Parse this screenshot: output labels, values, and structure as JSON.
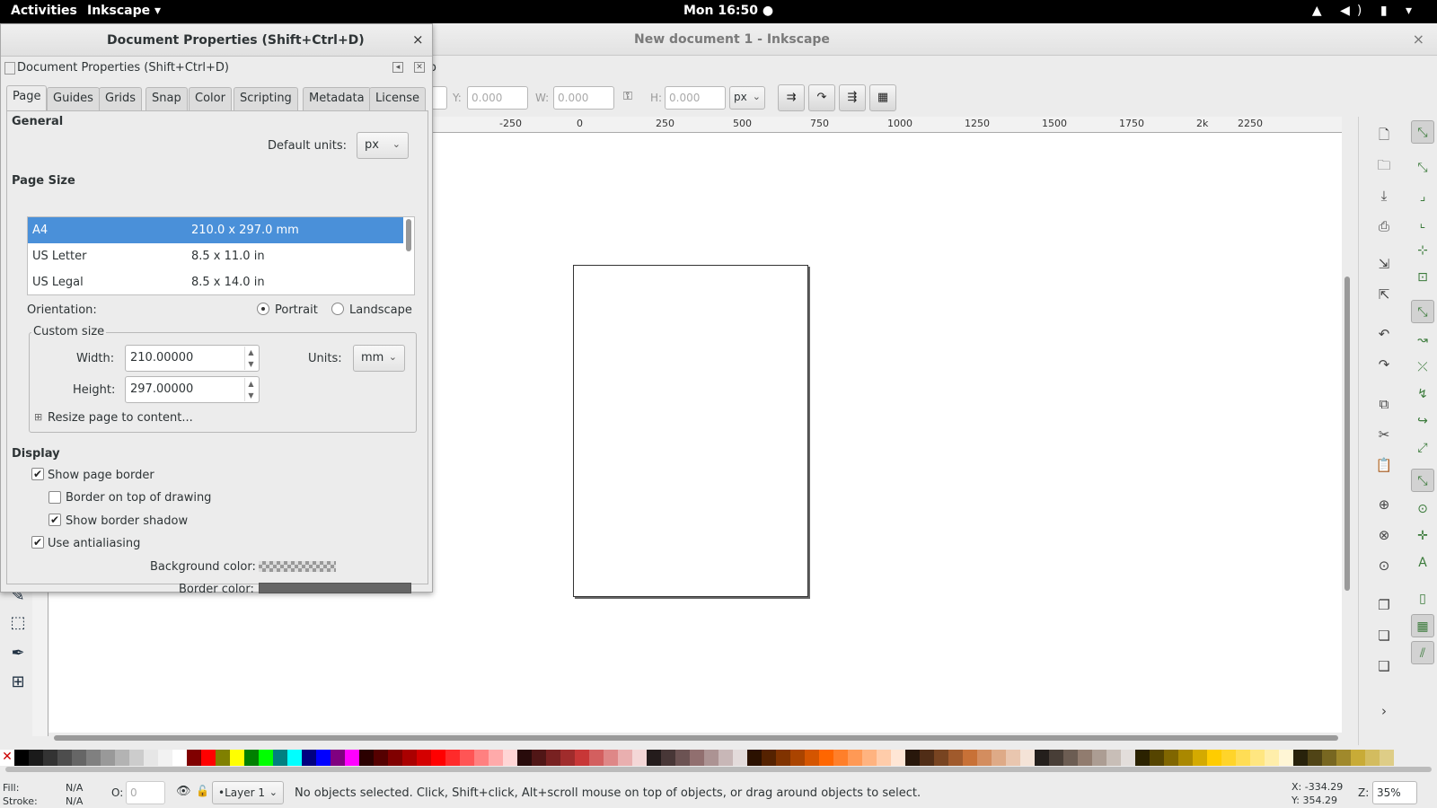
{
  "topbar": {
    "activities": "Activities",
    "app_menu": "Inkscape ▾",
    "clock": "Mon 16:50 ●",
    "tray": "▲ ◀) ▮ ▾"
  },
  "window": {
    "title": "New document 1 - Inkscape",
    "close": "×"
  },
  "menu_fragment": "lp",
  "selector_bar": {
    "y_label": "Y:",
    "y_value": "0.000",
    "w_label": "W:",
    "w_value": "0.000",
    "h_label": "H:",
    "h_value": "0.000",
    "units": "px"
  },
  "ruler": {
    "labels": [
      "0",
      "-250",
      "0",
      "250",
      "500",
      "750",
      "1000",
      "1250",
      "1500",
      "1750",
      "2k",
      "2250"
    ]
  },
  "dialog": {
    "window_title": "Document Properties (Shift+Ctrl+D)",
    "dock_title": "Document Properties (Shift+Ctrl+D)",
    "close": "×",
    "tabs": [
      "Page",
      "Guides",
      "Grids",
      "Snap",
      "Color",
      "Scripting",
      "Metadata",
      "License"
    ],
    "active_tab": "Page",
    "general": {
      "heading": "General",
      "default_units_label": "Default units:",
      "default_units_value": "px"
    },
    "page_size": {
      "heading": "Page Size",
      "rows": [
        {
          "name": "A4",
          "size": "210.0 x 297.0 mm",
          "selected": true
        },
        {
          "name": "US Letter",
          "size": "8.5 x 11.0 in",
          "selected": false
        },
        {
          "name": "US Legal",
          "size": "8.5 x 14.0 in",
          "selected": false
        }
      ],
      "orientation_label": "Orientation:",
      "portrait": "Portrait",
      "landscape": "Landscape",
      "orientation_selected": "Portrait"
    },
    "custom_size": {
      "legend": "Custom size",
      "width_label": "Width:",
      "width_value": "210.00000",
      "height_label": "Height:",
      "height_value": "297.00000",
      "units_label": "Units:",
      "units_value": "mm",
      "resize_expander": "Resize page to content..."
    },
    "display": {
      "heading": "Display",
      "show_page_border": "Show page border",
      "border_on_top": "Border on top of drawing",
      "show_border_shadow": "Show border shadow",
      "use_antialiasing": "Use antialiasing",
      "checked": {
        "show_page_border": true,
        "border_on_top": false,
        "show_border_shadow": true,
        "use_antialiasing": true
      },
      "background_color_label": "Background color:",
      "border_color_label": "Border color:",
      "border_color": "#666666"
    }
  },
  "statusbar": {
    "fill_label": "Fill:",
    "fill_value": "N/A",
    "stroke_label": "Stroke:",
    "stroke_value": "N/A",
    "opacity_label": "O:",
    "opacity_value": "0",
    "layer": "•Layer 1",
    "message": "No objects selected. Click, Shift+click, Alt+scroll mouse on top of objects, or drag around objects to select.",
    "x": "X: -334.29",
    "y": "Y:  354.29",
    "zoom_label": "Z:",
    "zoom_value": "35%"
  },
  "palette_colors": [
    "#000000",
    "#1a1a1a",
    "#333333",
    "#4d4d4d",
    "#666666",
    "#808080",
    "#999999",
    "#b3b3b3",
    "#cccccc",
    "#e6e6e6",
    "#f2f2f2",
    "#ffffff",
    "#800000",
    "#ff0000",
    "#808000",
    "#ffff00",
    "#008000",
    "#00ff00",
    "#008080",
    "#00ffff",
    "#000080",
    "#0000ff",
    "#800080",
    "#ff00ff",
    "#2b0000",
    "#550000",
    "#800000",
    "#aa0000",
    "#d40000",
    "#ff0000",
    "#ff2a2a",
    "#ff5555",
    "#ff8080",
    "#ffaaaa",
    "#ffd5d5",
    "#280b0b",
    "#501616",
    "#782121",
    "#a02c2c",
    "#c83737",
    "#d35f5f",
    "#de8787",
    "#e9afaf",
    "#f4d7d7",
    "#241c1c",
    "#483737",
    "#6c5353",
    "#916f6f",
    "#ac9393",
    "#c8b7b7",
    "#e3dbdb",
    "#2b1100",
    "#552200",
    "#803300",
    "#aa4400",
    "#d45500",
    "#ff6600",
    "#ff7f2a",
    "#ff9955",
    "#ffb380",
    "#ffccaa",
    "#ffe6d5",
    "#28170b",
    "#502d16",
    "#784421",
    "#a05a2c",
    "#c87137",
    "#d38d5f",
    "#deaa87",
    "#e9c6af",
    "#f4e3d7",
    "#241f1c",
    "#483e37",
    "#6c5d53",
    "#917c6f",
    "#ac9d93",
    "#c8beb7",
    "#e3dedb",
    "#2b2200",
    "#554400",
    "#806600",
    "#aa8800",
    "#d4aa00",
    "#ffcc00",
    "#ffd42a",
    "#ffdd55",
    "#ffe680",
    "#ffeeaa",
    "#fff6d5",
    "#28220b",
    "#504416",
    "#786721",
    "#a0892c",
    "#c8ab37",
    "#d3bc5f",
    "#decd87"
  ]
}
